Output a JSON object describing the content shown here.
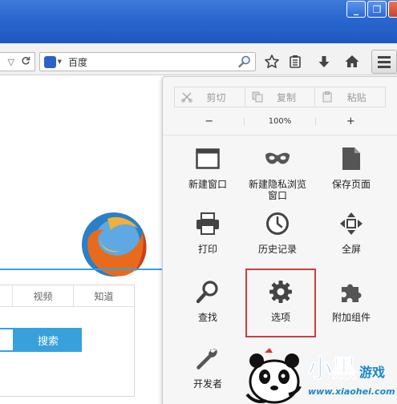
{
  "window": {
    "minimize_glyph": "_",
    "maximize_glyph": "❐",
    "close_glyph": "×"
  },
  "toolbar": {
    "search_placeholder": "百度",
    "search_engine_icon": "baidu-paw-icon",
    "icons": [
      "star-icon",
      "reading-list-icon",
      "download-icon",
      "home-icon",
      "hamburger-menu-icon"
    ]
  },
  "page": {
    "tabs": [
      "",
      "视频",
      "知道"
    ],
    "search_button": "搜索"
  },
  "menu": {
    "edit": {
      "cut": "剪切",
      "copy": "复制",
      "paste": "粘贴"
    },
    "zoom": {
      "out": "−",
      "level": "100%",
      "in": "+"
    },
    "items": [
      {
        "label": "新建窗口",
        "icon": "new-window-icon"
      },
      {
        "label": "新建隐私浏览\n窗口",
        "icon": "private-mask-icon"
      },
      {
        "label": "保存页面",
        "icon": "save-page-icon"
      },
      {
        "label": "打印",
        "icon": "printer-icon"
      },
      {
        "label": "历史记录",
        "icon": "history-clock-icon"
      },
      {
        "label": "全屏",
        "icon": "fullscreen-icon"
      },
      {
        "label": "查找",
        "icon": "find-magnifier-icon"
      },
      {
        "label": "选项",
        "icon": "options-gear-icon"
      },
      {
        "label": "附加组件",
        "icon": "addons-puzzle-icon"
      },
      {
        "label": "开发者",
        "icon": "developer-wrench-icon"
      }
    ]
  },
  "watermark": {
    "brand": "小黑游戏",
    "url": "www.xiaohei.com"
  },
  "colors": {
    "highlight": "#c94040",
    "accent": "#38a1db",
    "titlebar": "#2a66cf"
  }
}
